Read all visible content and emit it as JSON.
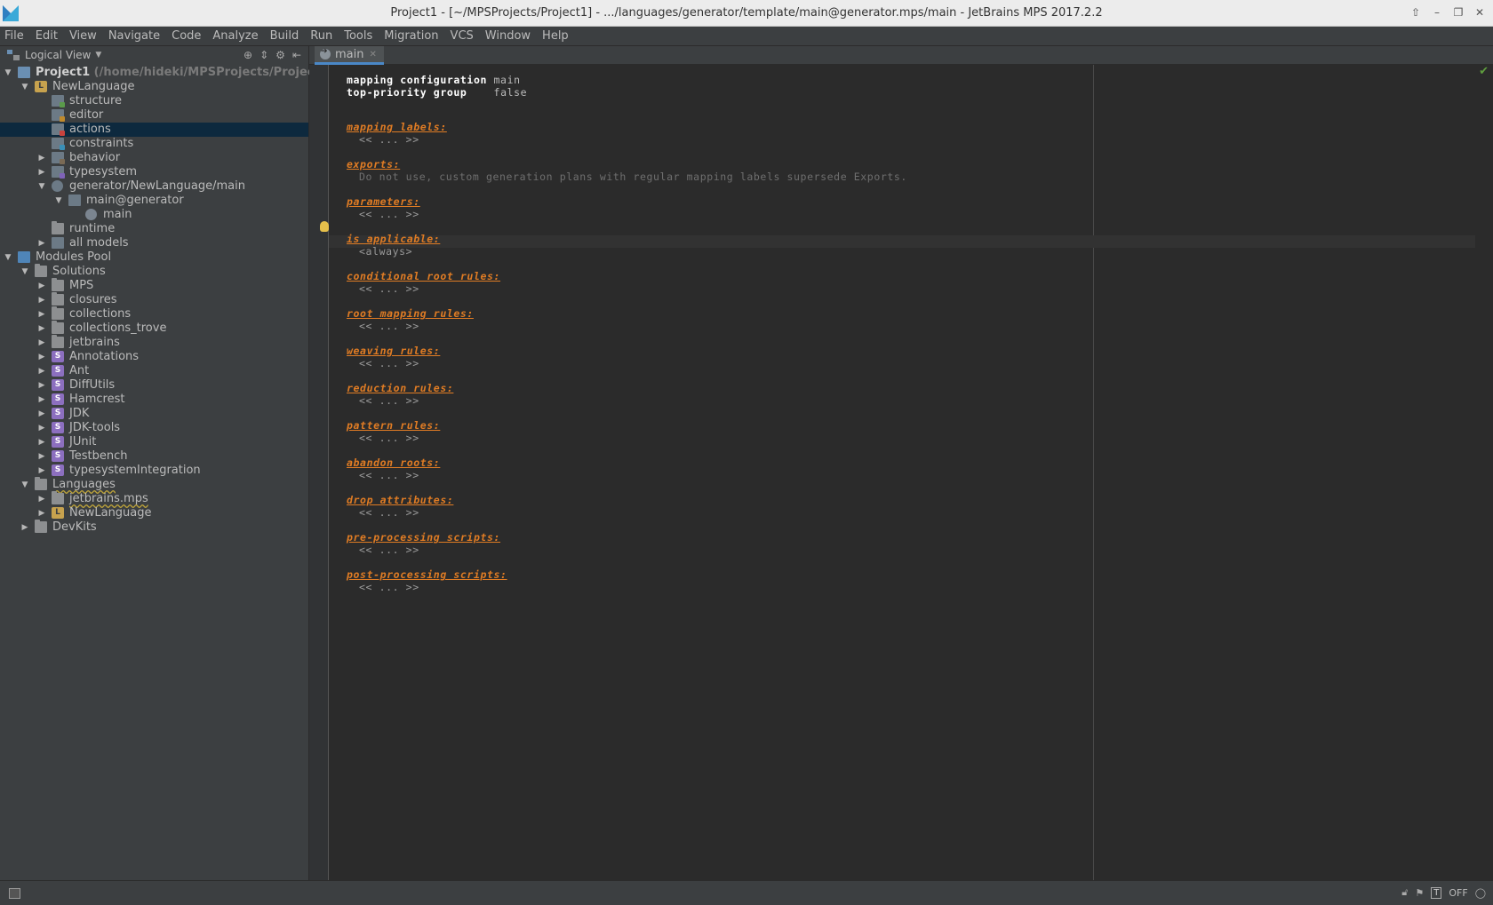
{
  "window": {
    "title": "Project1 - [~/MPSProjects/Project1] - .../languages/generator/template/main@generator.mps/main - JetBrains MPS 2017.2.2"
  },
  "menu": [
    "File",
    "Edit",
    "View",
    "Navigate",
    "Code",
    "Analyze",
    "Build",
    "Run",
    "Tools",
    "Migration",
    "VCS",
    "Window",
    "Help"
  ],
  "project_panel": {
    "view_label": "Logical View",
    "tree": [
      {
        "label": "Project1",
        "extra": "(/home/hideki/MPSProjects/Project1)",
        "depth": 0,
        "icon": "project-icon",
        "arrow": "down",
        "bold": true
      },
      {
        "label": "NewLanguage",
        "depth": 1,
        "icon": "language-icon",
        "arrow": "down"
      },
      {
        "label": "structure",
        "depth": 2,
        "icon": "structure-aspect-icon",
        "arrow": "none"
      },
      {
        "label": "editor",
        "depth": 2,
        "icon": "editor-aspect-icon",
        "arrow": "none"
      },
      {
        "label": "actions",
        "depth": 2,
        "icon": "actions-aspect-icon",
        "arrow": "none",
        "selected": true
      },
      {
        "label": "constraints",
        "depth": 2,
        "icon": "constraints-aspect-icon",
        "arrow": "none"
      },
      {
        "label": "behavior",
        "depth": 2,
        "icon": "behavior-aspect-icon",
        "arrow": "right"
      },
      {
        "label": "typesystem",
        "depth": 2,
        "icon": "typesystem-aspect-icon",
        "arrow": "right"
      },
      {
        "label": "generator/NewLanguage/main",
        "depth": 2,
        "icon": "generator-icon",
        "arrow": "down"
      },
      {
        "label": "main@generator",
        "depth": 3,
        "icon": "template-model-icon",
        "arrow": "down"
      },
      {
        "label": "main",
        "depth": 4,
        "icon": "root-node-icon",
        "arrow": "none"
      },
      {
        "label": "runtime",
        "depth": 2,
        "icon": "folder-icon",
        "arrow": "none"
      },
      {
        "label": "all models",
        "depth": 2,
        "icon": "all-models-icon",
        "arrow": "right"
      },
      {
        "label": "Modules Pool",
        "depth": 0,
        "icon": "modules-pool-icon",
        "arrow": "down"
      },
      {
        "label": "Solutions",
        "depth": 1,
        "icon": "folder-icon",
        "arrow": "down"
      },
      {
        "label": "MPS",
        "depth": 2,
        "icon": "folder-icon",
        "arrow": "right"
      },
      {
        "label": "closures",
        "depth": 2,
        "icon": "folder-icon",
        "arrow": "right"
      },
      {
        "label": "collections",
        "depth": 2,
        "icon": "folder-icon",
        "arrow": "right"
      },
      {
        "label": "collections_trove",
        "depth": 2,
        "icon": "folder-icon",
        "arrow": "right"
      },
      {
        "label": "jetbrains",
        "depth": 2,
        "icon": "folder-icon",
        "arrow": "right"
      },
      {
        "label": "Annotations",
        "depth": 2,
        "icon": "solution-icon",
        "arrow": "right"
      },
      {
        "label": "Ant",
        "depth": 2,
        "icon": "solution-icon",
        "arrow": "right"
      },
      {
        "label": "DiffUtils",
        "depth": 2,
        "icon": "solution-icon",
        "arrow": "right"
      },
      {
        "label": "Hamcrest",
        "depth": 2,
        "icon": "solution-icon",
        "arrow": "right"
      },
      {
        "label": "JDK",
        "depth": 2,
        "icon": "solution-icon",
        "arrow": "right"
      },
      {
        "label": "JDK-tools",
        "depth": 2,
        "icon": "solution-icon",
        "arrow": "right"
      },
      {
        "label": "JUnit",
        "depth": 2,
        "icon": "solution-icon",
        "arrow": "right"
      },
      {
        "label": "Testbench",
        "depth": 2,
        "icon": "solution-icon",
        "arrow": "right"
      },
      {
        "label": "typesystemIntegration",
        "depth": 2,
        "icon": "solution-icon",
        "arrow": "right"
      },
      {
        "label": "Languages",
        "depth": 1,
        "icon": "folder-icon",
        "arrow": "down",
        "wavy": true
      },
      {
        "label": "jetbrains.mps",
        "depth": 2,
        "icon": "folder-icon",
        "arrow": "right",
        "wavy": true
      },
      {
        "label": "NewLanguage",
        "depth": 2,
        "icon": "language-icon",
        "arrow": "right"
      },
      {
        "label": "DevKits",
        "depth": 1,
        "icon": "folder-icon",
        "arrow": "right"
      }
    ]
  },
  "editor_tab": {
    "label": "main"
  },
  "editor": {
    "header": [
      {
        "key": "mapping configuration",
        "value": "main"
      },
      {
        "key": "top-priority group",
        "value": "false"
      }
    ],
    "sections": [
      {
        "title": "mapping labels:",
        "body": "<< ... >>",
        "kind": "empty"
      },
      {
        "title": "exports:",
        "body": "Do not use, custom generation plans with regular mapping labels supersede Exports.",
        "kind": "desc"
      },
      {
        "title": "parameters:",
        "body": "<< ... >>",
        "kind": "empty"
      },
      {
        "title": "is applicable:",
        "body": "<always>",
        "kind": "empty"
      },
      {
        "title": "conditional root rules:",
        "body": "<< ... >>",
        "kind": "empty"
      },
      {
        "title": "root mapping rules:",
        "body": "<< ... >>",
        "kind": "empty"
      },
      {
        "title": "weaving rules:",
        "body": "<< ... >>",
        "kind": "empty"
      },
      {
        "title": "reduction rules:",
        "body": "<< ... >>",
        "kind": "empty"
      },
      {
        "title": "pattern rules:",
        "body": "<< ... >>",
        "kind": "empty"
      },
      {
        "title": "abandon roots:",
        "body": "<< ... >>",
        "kind": "empty"
      },
      {
        "title": "drop attributes:",
        "body": "<< ... >>",
        "kind": "empty"
      },
      {
        "title": "pre-processing scripts:",
        "body": "<< ... >>",
        "kind": "empty"
      },
      {
        "title": "post-processing scripts:",
        "body": "<< ... >>",
        "kind": "empty"
      }
    ]
  },
  "status": {
    "toggle_label": "OFF"
  },
  "colors": {
    "accent": "#4a88c7",
    "section": "#e07c24",
    "selection": "#0d293e"
  }
}
